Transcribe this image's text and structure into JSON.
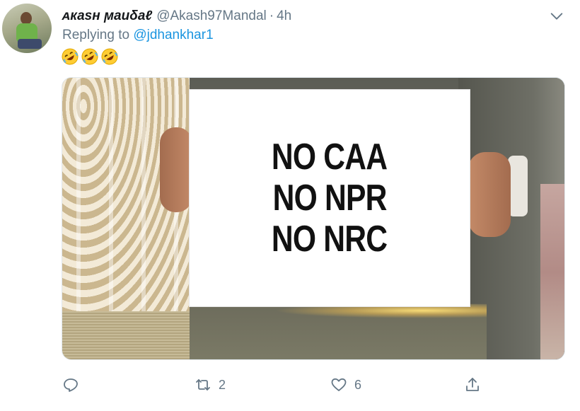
{
  "tweet": {
    "display_name": "ᴀкаѕн ϻаиδаℓ",
    "handle": "@Akash97Mandal",
    "separator": "·",
    "time": "4h",
    "reply_prefix": "Replying to",
    "reply_to": "@jdhankhar1",
    "emojis": [
      "rolling-on-floor-laughing",
      "rolling-on-floor-laughing",
      "rolling-on-floor-laughing"
    ]
  },
  "media": {
    "sign_lines": [
      "NO CAA",
      "NO NPR",
      "NO NRC"
    ]
  },
  "actions": {
    "reply_icon": "reply-icon",
    "retweet_icon": "retweet-icon",
    "retweet_count": "2",
    "like_icon": "heart-icon",
    "like_count": "6",
    "share_icon": "share-icon"
  },
  "colors": {
    "mention": "#1b95e0",
    "secondary_text": "#657786",
    "primary_text": "#14171a"
  }
}
